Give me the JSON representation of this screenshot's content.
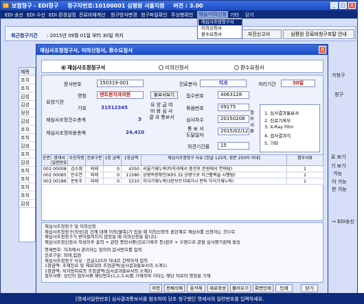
{
  "main_window": {
    "title": "보험청구 - EDI청구",
    "org_info": "청구자번호:10100001  심평원 서울지원",
    "version": "버전 : 3.00",
    "controls": [
      "_",
      "□",
      "X"
    ]
  },
  "menubar": {
    "items": [
      "EDI 송신",
      "EDI 수신",
      "EDI 환경설정",
      "진료비재계산",
      "청구방식변경",
      "청구파일확인",
      "주상병확인",
      "재심/이의신청",
      "기타",
      "닫기"
    ],
    "active_index": 7
  },
  "dropdown": {
    "items": [
      "재심사조정청구서",
      "이의신청서",
      "환수요청서"
    ],
    "selected_index": 0
  },
  "period_bar": {
    "label": "최근청구기간",
    "text": ": 2015년 09월 01일 부터 30일 까지",
    "btn_report": "자진신고서",
    "btn_receipt": "심평원 진료비청구포탈 안내"
  },
  "left_list": {
    "header": "제목",
    "rows": [
      "조치",
      "조치",
      "김성",
      "김성",
      "정진",
      "김성",
      "조치",
      "조치",
      "김성",
      "조치",
      "김성",
      "조치",
      "조치",
      "조치",
      "조치",
      "김성"
    ]
  },
  "right_side": {
    "texts": [
      "가청구",
      "청구",
      "로 보기",
      "가능",
      "기 보기",
      "이 가능",
      "한 가능"
    ],
    "edi_text": "→ EDI송신"
  },
  "dialog": {
    "title": "재심사조정청구서, 이의신청서, 환수요청서",
    "close": "X",
    "radios": [
      "재심사조정청구서",
      "이의신청서",
      "환수요청서"
    ],
    "radio_selected": 0,
    "form": {
      "doc_no_label": "문서번호",
      "doc_no": "150319-001",
      "dept_label": "진료분야",
      "dept": "치과",
      "deadline_label": "처리기간",
      "deadline": "30일",
      "org_label": "요양기관",
      "name_label": "명칭",
      "name": "덴트원치과의원",
      "btn_lookup": "통보서보기",
      "receipt_label": "접수번호",
      "receipt": "4063128",
      "code_label": "기호",
      "code": "31512345",
      "notice_label_1": "요 양 급 여",
      "notice_label_2": "비 용 심 사",
      "notice_label_3": "결 과 통보서",
      "bundle_label": "묶음번호",
      "bundle": "09175",
      "cases_label": "재심사조정건수총계",
      "cases": "3",
      "date_label": "심사차수",
      "date": "20150208",
      "amount_label": "재심사조정비용총액",
      "amount": "24,410",
      "notice_date_label_1": "통 보 서",
      "notice_date_label_2": "도달일자",
      "notice_date": "2015/02/12",
      "attach_label": "첨 부 서 류",
      "docs": [
        "1. 심사결과통보서",
        "2. 진료기록부",
        "3. X-Ray Film",
        "4. 검사결과지",
        "5. 기타"
      ],
      "opinion_label": "의견기간률",
      "opinion": "15"
    },
    "table": {
      "headers": [
        "순번",
        "명세서 일련번호",
        "수진자명",
        "진료구분",
        "1항 금액",
        "1항금액",
        "재심사조정청구 사유 [한글 125자, 영문 250자 이내]",
        "첨부서류"
      ],
      "rows": [
        [
          "001",
          "00008",
          "김소희",
          "외래",
          "0",
          "4350",
          "서울기재누락(타처과에서 충전후 문원에서 연마탐)",
          "1"
        ],
        [
          "002",
          "00085",
          "민수연",
          "외래",
          "0",
          "11580",
          "상병적용확인(K05.32 상병으로 치근활택술 시행탐)",
          "1"
        ],
        [
          "003",
          "00186",
          "문동주",
          "외래",
          "0",
          "5310",
          "치식기재누락(3분브트치재거시 판독 치식기재누락)",
          "1"
        ]
      ]
    },
    "notes": [
      "재심사조정청구 및 이의신청",
      "재심사조정청구(작성)된 건에 대해 이의(불복)가 있을 때 이의신청의 권한계로 재심사를 신청하는 것으로",
      "재심사조정청구가 받아들여지지 않았을 때 이의신청을 합니다.",
      "재심사조정신청서 작성이후 출력 + 관련 증빙서류(진료기록부 등)첨부 + 우편으로 관할 심사평가원에 발송",
      "",
      "명세번호: 치과에서 관리하는 임의의 문서번호를 입력",
      "진료구분: 외래,입원",
      "재심사조정청구 사유 : 한글125자 이내로 간략하게 입력",
      "1항금액: 초재진료 및 재료대의 조정금액(심사결과통보서의 소계1)",
      "1항금액: 처치방위료의 조정금액(심사결과통보서의 소계2)",
      "첨부서류: 상단의 첨부서류 해당번호(1,2,3,4)를 기재하며 기타는 해당 자료의 명칭을 기재"
    ],
    "buttons": [
      "저장",
      "전체삭제",
      "출석제",
      "새로작성",
      "불러오기",
      "화면인쇄",
      "인쇄",
      "닫기"
    ]
  },
  "status_bar": "[명세서일련번호] 심사결과통보서를 참조하여 당초 청구했던 명세서의 일련번호를 입력하세요."
}
